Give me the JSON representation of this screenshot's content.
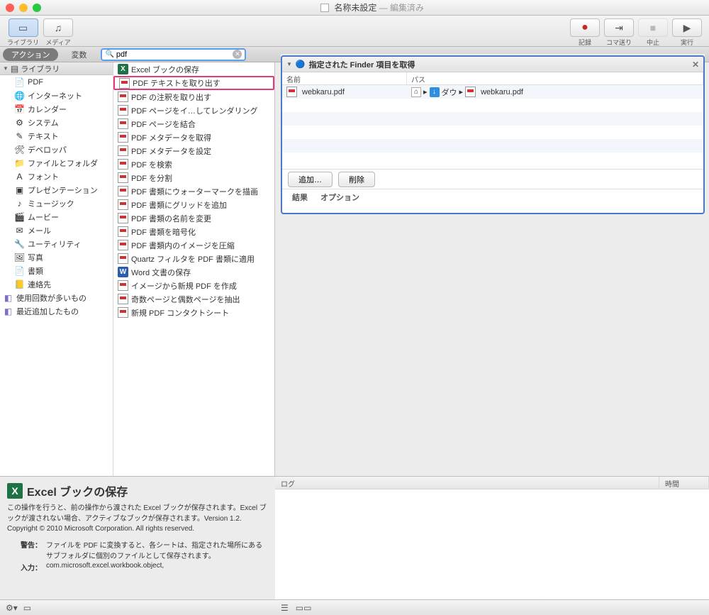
{
  "titlebar": {
    "doc": "名称未設定",
    "suffix": "編集済み"
  },
  "toolbar": {
    "left": [
      {
        "n": "library-btn",
        "label": "ライブラリ",
        "active": true,
        "glyph": "▭"
      },
      {
        "n": "media-btn",
        "label": "メディア",
        "glyph": "♫"
      }
    ],
    "right": [
      {
        "n": "record-btn",
        "label": "記録",
        "glyph": "●",
        "cls": "rec"
      },
      {
        "n": "step-btn",
        "label": "コマ送り",
        "glyph": "⇥"
      },
      {
        "n": "stop-btn",
        "label": "中止",
        "glyph": "■",
        "cls": "disabled"
      },
      {
        "n": "run-btn",
        "label": "実行",
        "glyph": "▶"
      }
    ]
  },
  "filter": {
    "action": "アクション",
    "vars": "変数",
    "search": "pdf"
  },
  "lib_header": "ライブラリ",
  "lib_items": [
    {
      "g": "📄",
      "t": "PDF"
    },
    {
      "g": "🌐",
      "t": "インターネット"
    },
    {
      "g": "📅",
      "t": "カレンダー"
    },
    {
      "g": "⚙︎",
      "t": "システム"
    },
    {
      "g": "✎",
      "t": "テキスト"
    },
    {
      "g": "🛠",
      "t": "デベロッパ"
    },
    {
      "g": "📁",
      "t": "ファイルとフォルダ"
    },
    {
      "g": "A",
      "t": "フォント"
    },
    {
      "g": "▣",
      "t": "プレゼンテーション"
    },
    {
      "g": "♪",
      "t": "ミュージック"
    },
    {
      "g": "🎬",
      "t": "ムービー"
    },
    {
      "g": "✉︎",
      "t": "メール"
    },
    {
      "g": "🔧",
      "t": "ユーティリティ"
    },
    {
      "g": "🖼",
      "t": "写真"
    },
    {
      "g": "📄",
      "t": "書類"
    },
    {
      "g": "📒",
      "t": "連絡先"
    }
  ],
  "lib_extra": [
    {
      "g": "◧",
      "t": "使用回数が多いもの"
    },
    {
      "g": "◧",
      "t": "最近追加したもの"
    }
  ],
  "actions": [
    {
      "t": "Excel ブックの保存",
      "ico": "xl"
    },
    {
      "t": "PDF テキストを取り出す",
      "hl": true
    },
    {
      "t": "PDF の注釈を取り出す"
    },
    {
      "t": "PDF ページをイ…してレンダリング"
    },
    {
      "t": "PDF ページを結合"
    },
    {
      "t": "PDF メタデータを取得"
    },
    {
      "t": "PDF メタデータを設定"
    },
    {
      "t": "PDF を検索"
    },
    {
      "t": "PDF を分割"
    },
    {
      "t": "PDF 書類にウォーターマークを描画"
    },
    {
      "t": "PDF 書類にグリッドを追加"
    },
    {
      "t": "PDF 書類の名前を変更"
    },
    {
      "t": "PDF 書類を暗号化"
    },
    {
      "t": "PDF 書類内のイメージを圧縮"
    },
    {
      "t": "Quartz フィルタを PDF 書類に適用"
    },
    {
      "t": "Word 文書の保存",
      "ico": "w"
    },
    {
      "t": "イメージから新規 PDF を作成"
    },
    {
      "t": "奇数ページと偶数ページを抽出"
    },
    {
      "t": "新規 PDF コンタクトシート"
    }
  ],
  "workflow": {
    "title": "指定された Finder 項目を取得",
    "cols": {
      "name": "名前",
      "path": "パス"
    },
    "row": {
      "file": "webkaru.pdf",
      "dl": "ダウ",
      "pathfile": "webkaru.pdf"
    },
    "btns": {
      "add": "追加…",
      "del": "削除"
    },
    "tabs": {
      "res": "結果",
      "opt": "オプション"
    }
  },
  "logpanel": {
    "log": "ログ",
    "time": "時間"
  },
  "info": {
    "title": "Excel ブックの保存",
    "desc": "この操作を行うと、前の操作から渡された Excel ブックが保存されます。Excel ブックが渡されない場合、アクティブなブックが保存されます。Version 1.2. Copyright © 2010 Microsoft Corporation. All rights reserved.",
    "warn_k": "警告：",
    "warn_v": "ファイルを PDF に変換すると、各シートは、指定された場所にあるサブフォルダに個別のファイルとして保存されます。",
    "in_k": "入力：",
    "in_v": "com.microsoft.excel.workbook.object,"
  }
}
